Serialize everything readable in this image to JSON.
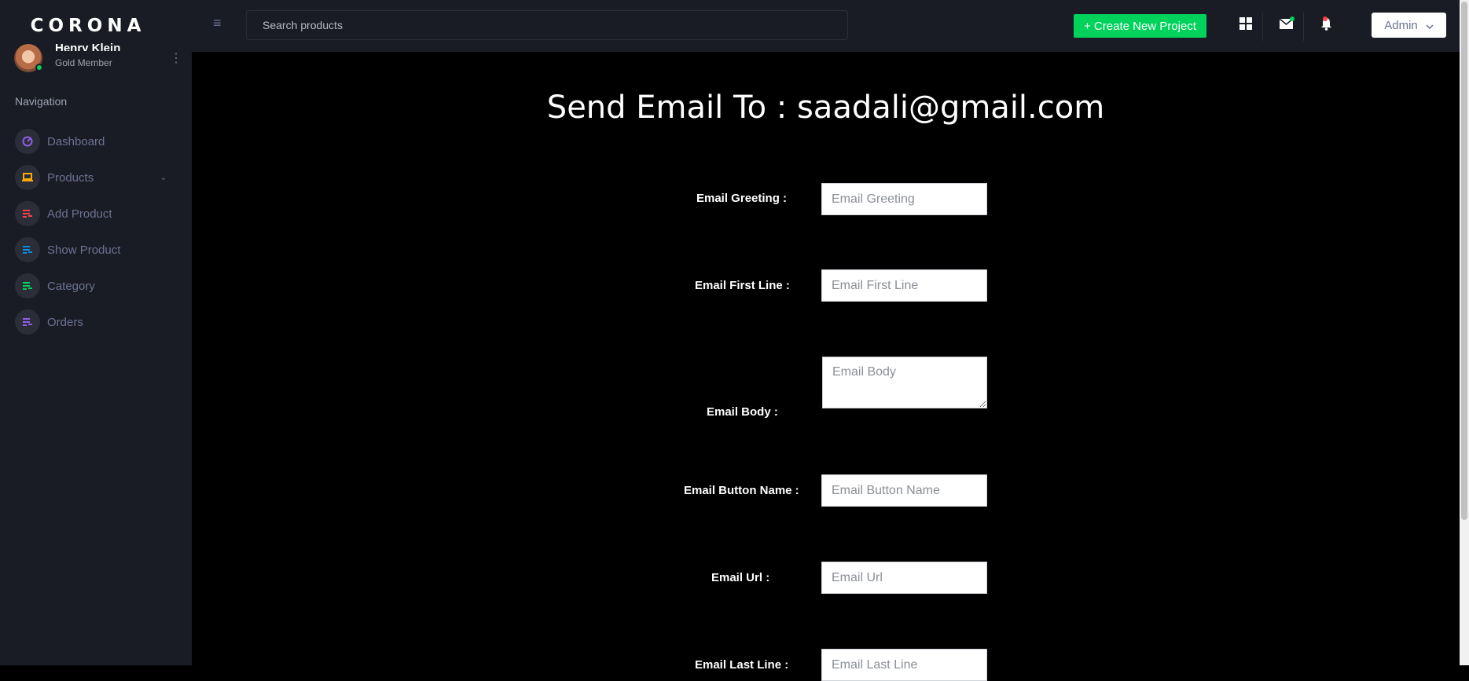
{
  "brand": "CORONA",
  "profile": {
    "name": "Henry Klein",
    "role": "Gold Member"
  },
  "nav": {
    "heading": "Navigation",
    "items": [
      {
        "label": "Dashboard",
        "icon": "speedometer-icon",
        "color": "#8f5fe8"
      },
      {
        "label": "Products",
        "icon": "laptop-icon",
        "color": "#ffab00",
        "arrow": "⌄"
      },
      {
        "label": "Add Product",
        "icon": "playlist-icon",
        "color": "#fc424a"
      },
      {
        "label": "Show Product",
        "icon": "playlist-icon",
        "color": "#0090e7"
      },
      {
        "label": "Category",
        "icon": "playlist-icon",
        "color": "#00d25b"
      },
      {
        "label": "Orders",
        "icon": "playlist-icon",
        "color": "#8f5fe8"
      }
    ]
  },
  "topbar": {
    "search_placeholder": "Search products",
    "create_label": "+ Create New Project",
    "admin_label": "Admin"
  },
  "colors": {
    "accent": "#00d25b",
    "sidebar_bg": "#191c24",
    "notification": "#fc424a"
  },
  "page": {
    "title": "Send Email To : saadali@gmail.com",
    "fields": [
      {
        "label": "Email Greeting :",
        "placeholder": "Email Greeting"
      },
      {
        "label": "Email First Line :",
        "placeholder": "Email First Line"
      },
      {
        "label": "Email Body :",
        "placeholder": "Email Body"
      },
      {
        "label": "Email Button Name :",
        "placeholder": "Email Button Name"
      },
      {
        "label": "Email Url :",
        "placeholder": "Email Url"
      },
      {
        "label": "Email Last Line :",
        "placeholder": "Email Last Line"
      }
    ]
  }
}
